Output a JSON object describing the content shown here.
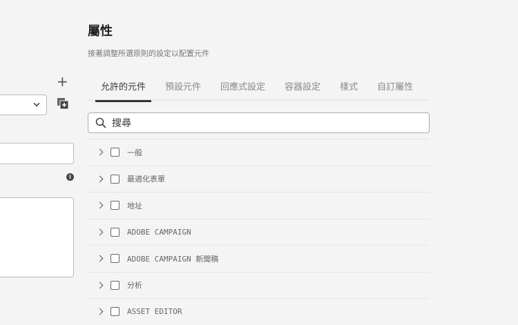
{
  "header": {
    "title": "屬性",
    "subtitle": "接著調整所選原則的設定以配置元件"
  },
  "tabs": [
    {
      "label": "允許的元件"
    },
    {
      "label": "預設元件"
    },
    {
      "label": "回應式設定"
    },
    {
      "label": "容器設定"
    },
    {
      "label": "樣式"
    },
    {
      "label": "自訂屬性"
    }
  ],
  "search": {
    "placeholder": "搜尋"
  },
  "left": {
    "plus": "+",
    "info": "i"
  },
  "groups": [
    {
      "label": "一般"
    },
    {
      "label": "最適化表單"
    },
    {
      "label": "地址"
    },
    {
      "label": "ADOBE CAMPAIGN"
    },
    {
      "label": "ADOBE CAMPAIGN 新聞稿"
    },
    {
      "label": "分析"
    },
    {
      "label": "ASSET EDITOR"
    }
  ]
}
